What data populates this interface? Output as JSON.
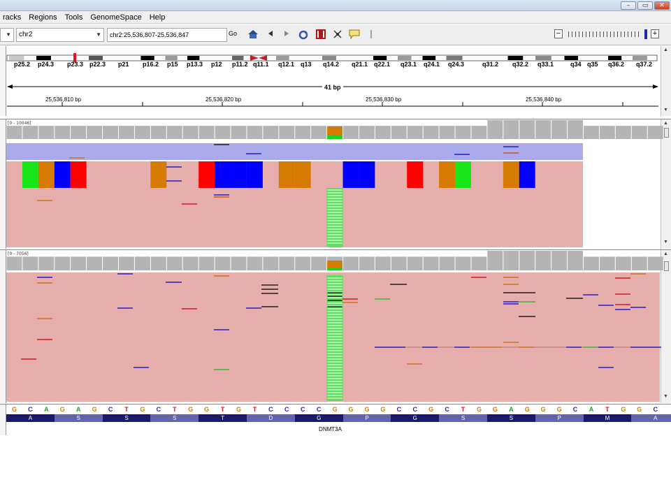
{
  "menu": {
    "items": [
      "racks",
      "Regions",
      "Tools",
      "GenomeSpace",
      "Help"
    ]
  },
  "window": {
    "buttons": [
      "–",
      "▭",
      "✕"
    ]
  },
  "toolbar": {
    "genome_value": "",
    "chromosome": "chr2",
    "locus": "chr2:25,536,807-25,536,847",
    "go_label": "Go"
  },
  "ideogram": {
    "bands": [
      "p25.2",
      "p24.3",
      "p23.3",
      "p22.3",
      "p21",
      "p16.2",
      "p15",
      "p13.3",
      "p12",
      "p11.2",
      "q11.1",
      "q12.1",
      "q13",
      "q14.2",
      "q21.1",
      "q22.1",
      "q23.1",
      "q24.1",
      "q24.3",
      "q31.2",
      "q32.2",
      "q33.1",
      "q34",
      "q35",
      "q36.2",
      "q37.2"
    ]
  },
  "ruler": {
    "range_label": "41 bp",
    "ticks": [
      "25,536,810 bp",
      "25,536,820 bp",
      "25,536,830 bp",
      "25,536,840 bp"
    ]
  },
  "tracks": [
    {
      "range": "[0 - 10046]"
    },
    {
      "range": "[0 - 7056]"
    }
  ],
  "sequence": {
    "bases": [
      "G",
      "C",
      "A",
      "G",
      "A",
      "G",
      "C",
      "T",
      "G",
      "C",
      "T",
      "G",
      "G",
      "T",
      "G",
      "T",
      "C",
      "C",
      "C",
      "C",
      "G",
      "G",
      "G",
      "G",
      "C",
      "C",
      "G",
      "C",
      "T",
      "G",
      "G",
      "A",
      "G",
      "G",
      "G",
      "C",
      "A",
      "T",
      "G",
      "G",
      "C"
    ],
    "aminoacids": [
      "A",
      "S",
      "S",
      "S",
      "T",
      "D",
      "G",
      "P",
      "G",
      "S",
      "S",
      "P",
      "M",
      "A"
    ],
    "gene": "DNMT3A"
  },
  "colors": {
    "A": "#1aa31a",
    "C": "#1a1acc",
    "G": "#d67a00",
    "T": "#dd1111",
    "read": "#e7aeae",
    "pairedblue": "#aaaaea",
    "coverage": "#b4b4b4",
    "aa_dark": "#1a1a6b",
    "aa_light": "#6363b0"
  }
}
